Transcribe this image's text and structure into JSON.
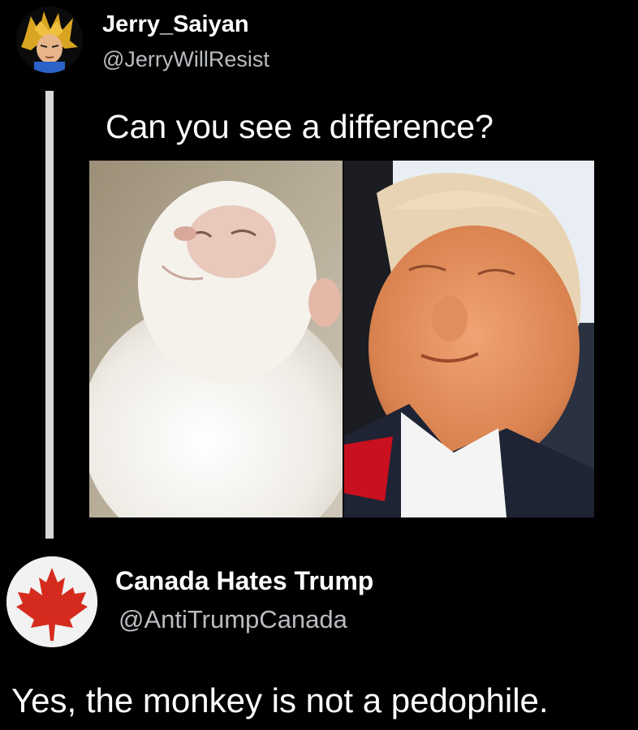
{
  "tweet": {
    "author_name": "Jerry_Saiyan",
    "author_handle": "@JerryWillResist",
    "text": "Can you see a difference?",
    "avatar_icon": "anime-character-avatar-icon",
    "images": [
      {
        "description_icon": "white-monkey-photo"
      },
      {
        "description_icon": "sleeping-man-photo"
      }
    ]
  },
  "reply": {
    "author_name": "Canada Hates Trump",
    "author_handle": "@AntiTrumpCanada",
    "text": "Yes, the monkey is not a pedophile.",
    "avatar_icon": "maple-leaf-icon"
  },
  "colors": {
    "background": "#000000",
    "text": "#ffffff",
    "handle": "#b9bcc0",
    "thread_line": "#d9d9d9",
    "maple_red": "#d52b1e"
  }
}
